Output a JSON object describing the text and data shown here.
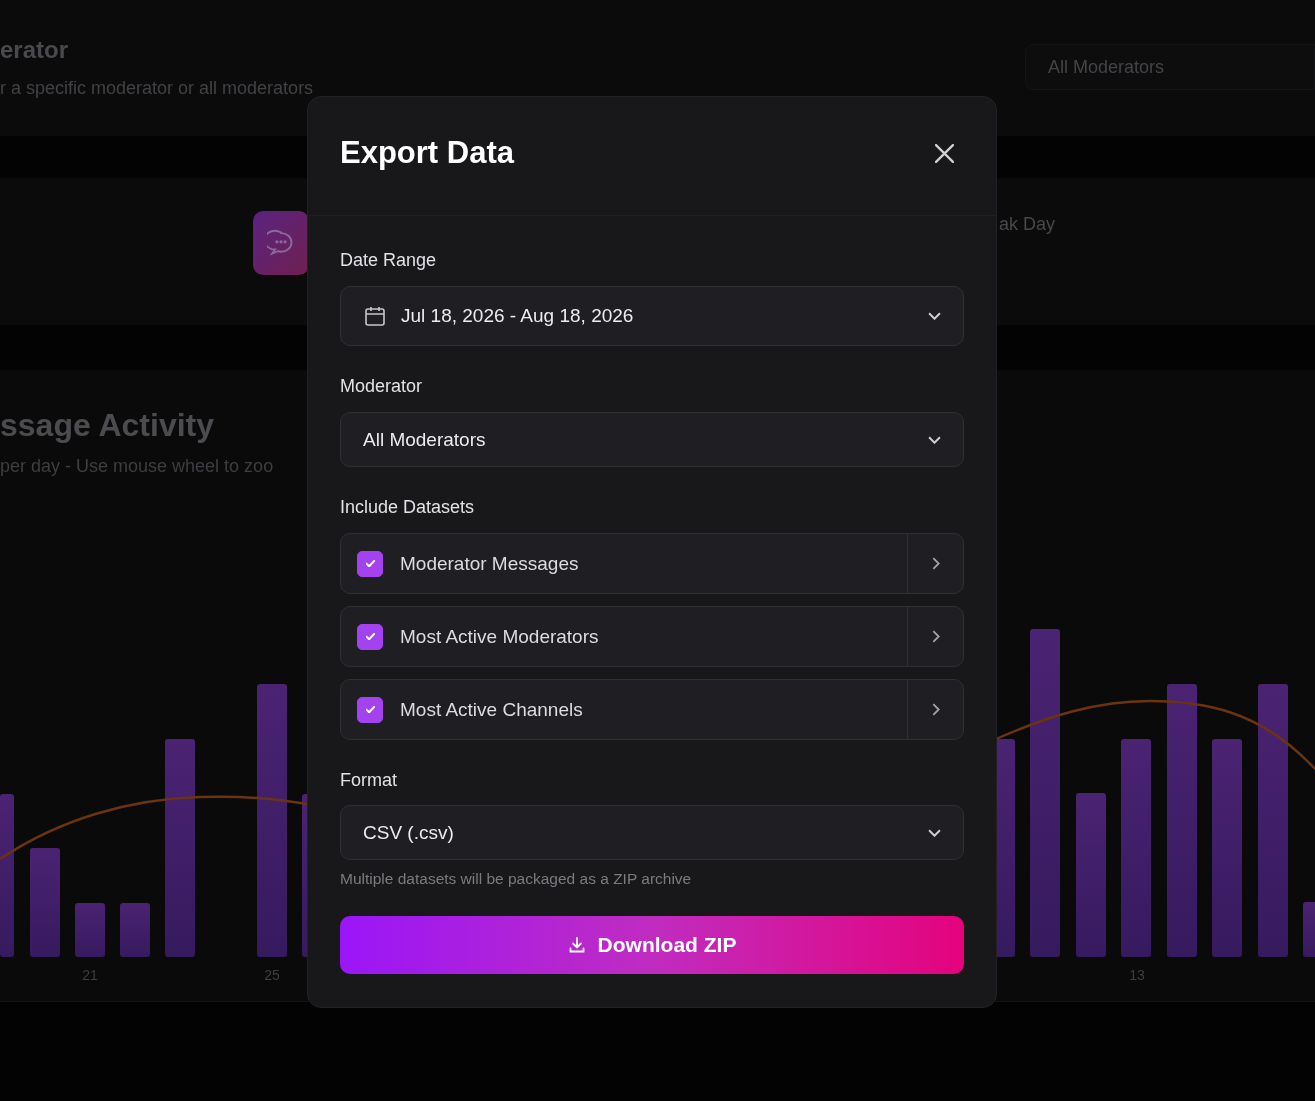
{
  "background": {
    "filter_title": "erator",
    "filter_subtitle": "r a specific moderator or all moderators",
    "filter_select": "All Moderators",
    "stat_label": "ak Day",
    "chart_title": "ssage Activity",
    "chart_subtitle": "per day - Use mouse wheel to zoo",
    "x_labels": [
      "21",
      "25",
      "13"
    ]
  },
  "dialog": {
    "title": "Export Data",
    "date_range": {
      "label": "Date Range",
      "value": "Jul 18, 2026 - Aug 18, 2026"
    },
    "moderator": {
      "label": "Moderator",
      "value": "All Moderators"
    },
    "datasets": {
      "label": "Include Datasets",
      "items": [
        {
          "name": "Moderator Messages",
          "checked": true
        },
        {
          "name": "Most Active Moderators",
          "checked": true
        },
        {
          "name": "Most Active Channels",
          "checked": true
        }
      ]
    },
    "format": {
      "label": "Format",
      "value": "CSV (.csv)",
      "hint": "Multiple datasets will be packaged as a ZIP archive"
    },
    "button": "Download ZIP"
  }
}
